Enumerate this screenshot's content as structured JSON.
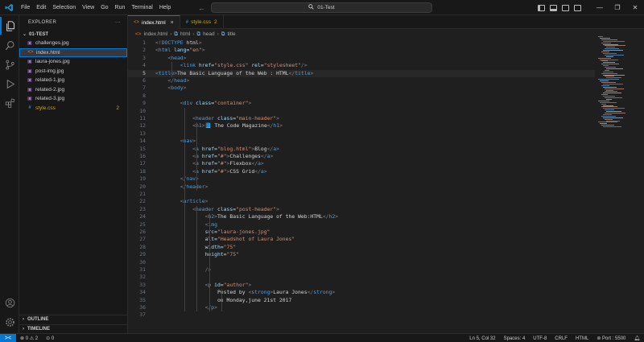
{
  "titlebar": {
    "menu": [
      "File",
      "Edit",
      "Selection",
      "View",
      "Go",
      "Run",
      "Terminal",
      "Help"
    ],
    "search_text": "01-Test"
  },
  "sidebar": {
    "title": "EXPLORER",
    "more": "···",
    "folder": "01-TEST",
    "files": [
      {
        "name": "challenges.jpg",
        "icon": "image-icon",
        "badge": ""
      },
      {
        "name": "index.html",
        "icon": "html-icon",
        "badge": ""
      },
      {
        "name": "laura-jones.jpg",
        "icon": "image-icon",
        "badge": ""
      },
      {
        "name": "post-img.jpg",
        "icon": "image-icon",
        "badge": ""
      },
      {
        "name": "related-1.jpg",
        "icon": "image-icon",
        "badge": ""
      },
      {
        "name": "related-2.jpg",
        "icon": "image-icon",
        "badge": ""
      },
      {
        "name": "related-3.jpg",
        "icon": "image-icon",
        "badge": ""
      },
      {
        "name": "style.css",
        "icon": "css-icon",
        "badge": "2"
      }
    ],
    "outline": "OUTLINE",
    "timeline": "TIMELINE"
  },
  "tabs": [
    {
      "label": "index.html",
      "close": "×",
      "modified": ""
    },
    {
      "label": "style.css",
      "close": "",
      "modified": "2"
    }
  ],
  "breadcrumb": [
    "index.html",
    "html",
    "head",
    "title"
  ],
  "editor": {
    "current_line": 5,
    "lines": [
      "<!DOCTYPE html>",
      "<html lang=\"en\">",
      "    <head>",
      "        <link href=\"style.css\" rel=\"stylesheet\"/>",
      "<title>The Basic Language of the Web : HTML</title>",
      "    </head>",
      "    <body>",
      "",
      "        <div class=\"container\">",
      "",
      "            <header class=\"main-header\">",
      "            <h1>📘 The Code Magazine</h1>",
      "",
      "        <nav>",
      "            <a href=\"blog.html\">Blog</a>",
      "            <a href=\"#\">Challenges</a>",
      "            <a href=\"#\">Flexbox</a>",
      "            <a href=\"#\">CSS Grid</a>",
      "        </nav>",
      "        </header>",
      "",
      "        <article>",
      "            <header class=\"post-header\">",
      "                <h2>The Basic Language of the Web:HTML</h2>",
      "                <img",
      "                src=\"laura-jones.jpg\"",
      "                alt=\"Headshot of Laura Jones\"",
      "                width=\"75\"",
      "                height=\"75\"",
      "",
      "                />",
      "",
      "                <p id=\"author\">",
      "                    Posted by <strong>Laura Jones</strong>",
      "                    on Monday,june 21st 2017",
      "                </p>",
      ""
    ]
  },
  "statusbar": {
    "remote": "><",
    "errors": "0",
    "warnings": "2",
    "ports": "0",
    "position": "Ln 5, Col 32",
    "spaces": "Spaces: 4",
    "encoding": "UTF-8",
    "eol": "CRLF",
    "language": "HTML",
    "port": "Port : 5500"
  },
  "colors": {
    "accent": "#0078d4",
    "tag": "#569cd6",
    "attribute": "#9cdcfe",
    "string": "#ce9178",
    "warning": "#cca700"
  }
}
